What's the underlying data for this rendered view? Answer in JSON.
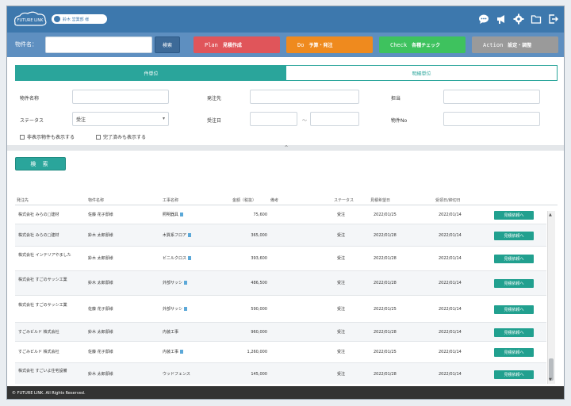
{
  "header": {
    "logo_text": "FUTURE LINK",
    "user_label": "鈴木 営業部 様",
    "icons": [
      "chat-icon",
      "megaphone-icon",
      "gear-icon",
      "folder-icon",
      "logout-icon"
    ]
  },
  "search": {
    "label": "物件名：",
    "value": "",
    "button": "検索"
  },
  "pdca": [
    {
      "en": "Plan",
      "jp": "見積作成",
      "color": "#e0555a"
    },
    {
      "en": "Do",
      "jp": "予算・発注",
      "color": "#ef8a1e"
    },
    {
      "en": "Check",
      "jp": "各種チェック",
      "color": "#3ec25e"
    },
    {
      "en": "Action",
      "jp": "設定・調整",
      "color": "#9a9a9a"
    }
  ],
  "tabs": {
    "active": "件単位",
    "inactive": "明細単位"
  },
  "filters": {
    "property_name": "物件名称",
    "order_from": "発注先",
    "person": "担当",
    "status": "ステータス",
    "status_value": "受注",
    "order_date": "受注日",
    "range_sep": "〜",
    "property_no": "物件No",
    "show_hidden": "非表示物件も表示する",
    "show_done": "完了済みも表示する"
  },
  "collapse_label": "^",
  "run_button": "検 索",
  "table": {
    "headers": [
      "発注先",
      "物件名称",
      "工事名称",
      "金額（税抜）",
      "備考",
      "ステータス",
      "見積希望日",
      "受領日/締切日"
    ],
    "rows": [
      {
        "supplier": "株式会社 みらの□建材",
        "prop": "佐藤 花子邸様",
        "work": "照明器具",
        "file": true,
        "amount": "75,600",
        "status": "受注",
        "d1": "2022/01/25",
        "d2": "2022/01/14",
        "btn": "見積依頼へ"
      },
      {
        "supplier": "株式会社 みらの□建材",
        "prop": "鈴木 太郎邸様",
        "work": "木質系フロア",
        "file": true,
        "amount": "365,000",
        "status": "受注",
        "d1": "2022/01/28",
        "d2": "2022/01/14",
        "btn": "見積依頼へ"
      },
      {
        "supplier": "株式会社 インテリアやました",
        "prop": "鈴木 太郎邸様",
        "work": "ビニルクロス",
        "file": true,
        "amount": "393,600",
        "status": "受注",
        "d1": "2022/01/28",
        "d2": "2022/01/14",
        "btn": "見積依頼へ"
      },
      {
        "supplier": "株式会社 すごのサッシ工業",
        "prop": "鈴木 太郎邸様",
        "work": "外部サッシ",
        "file": true,
        "amount": "486,500",
        "status": "受注",
        "d1": "2022/01/28",
        "d2": "2022/01/14",
        "btn": "見積依頼へ"
      },
      {
        "supplier": "株式会社 すごのサッシ工業",
        "prop": "佐藤 花子邸様",
        "work": "外部サッシ",
        "file": true,
        "amount": "590,000",
        "status": "受注",
        "d1": "2022/01/25",
        "d2": "2022/01/14",
        "btn": "見積依頼へ"
      },
      {
        "supplier": "すごみビルド 株式会社",
        "prop": "鈴木 太郎邸様",
        "work": "内装工事",
        "file": false,
        "amount": "960,000",
        "status": "受注",
        "d1": "2022/01/28",
        "d2": "2022/01/14",
        "btn": "見積依頼へ"
      },
      {
        "supplier": "すごみビルド 株式会社",
        "prop": "佐藤 花子邸様",
        "work": "内装工事",
        "file": true,
        "amount": "1,260,000",
        "status": "受注",
        "d1": "2022/01/25",
        "d2": "2022/01/14",
        "btn": "見積依頼へ"
      },
      {
        "supplier": "株式会社 すごいよ住宅設備",
        "prop": "鈴木 太郎邸様",
        "work": "ウッドフェンス",
        "file": false,
        "amount": "145,000",
        "status": "受注",
        "d1": "2022/01/28",
        "d2": "2022/01/14",
        "btn": "見積依頼へ"
      }
    ]
  },
  "footer": "© FUTURE LINK. All Rights Reserved."
}
